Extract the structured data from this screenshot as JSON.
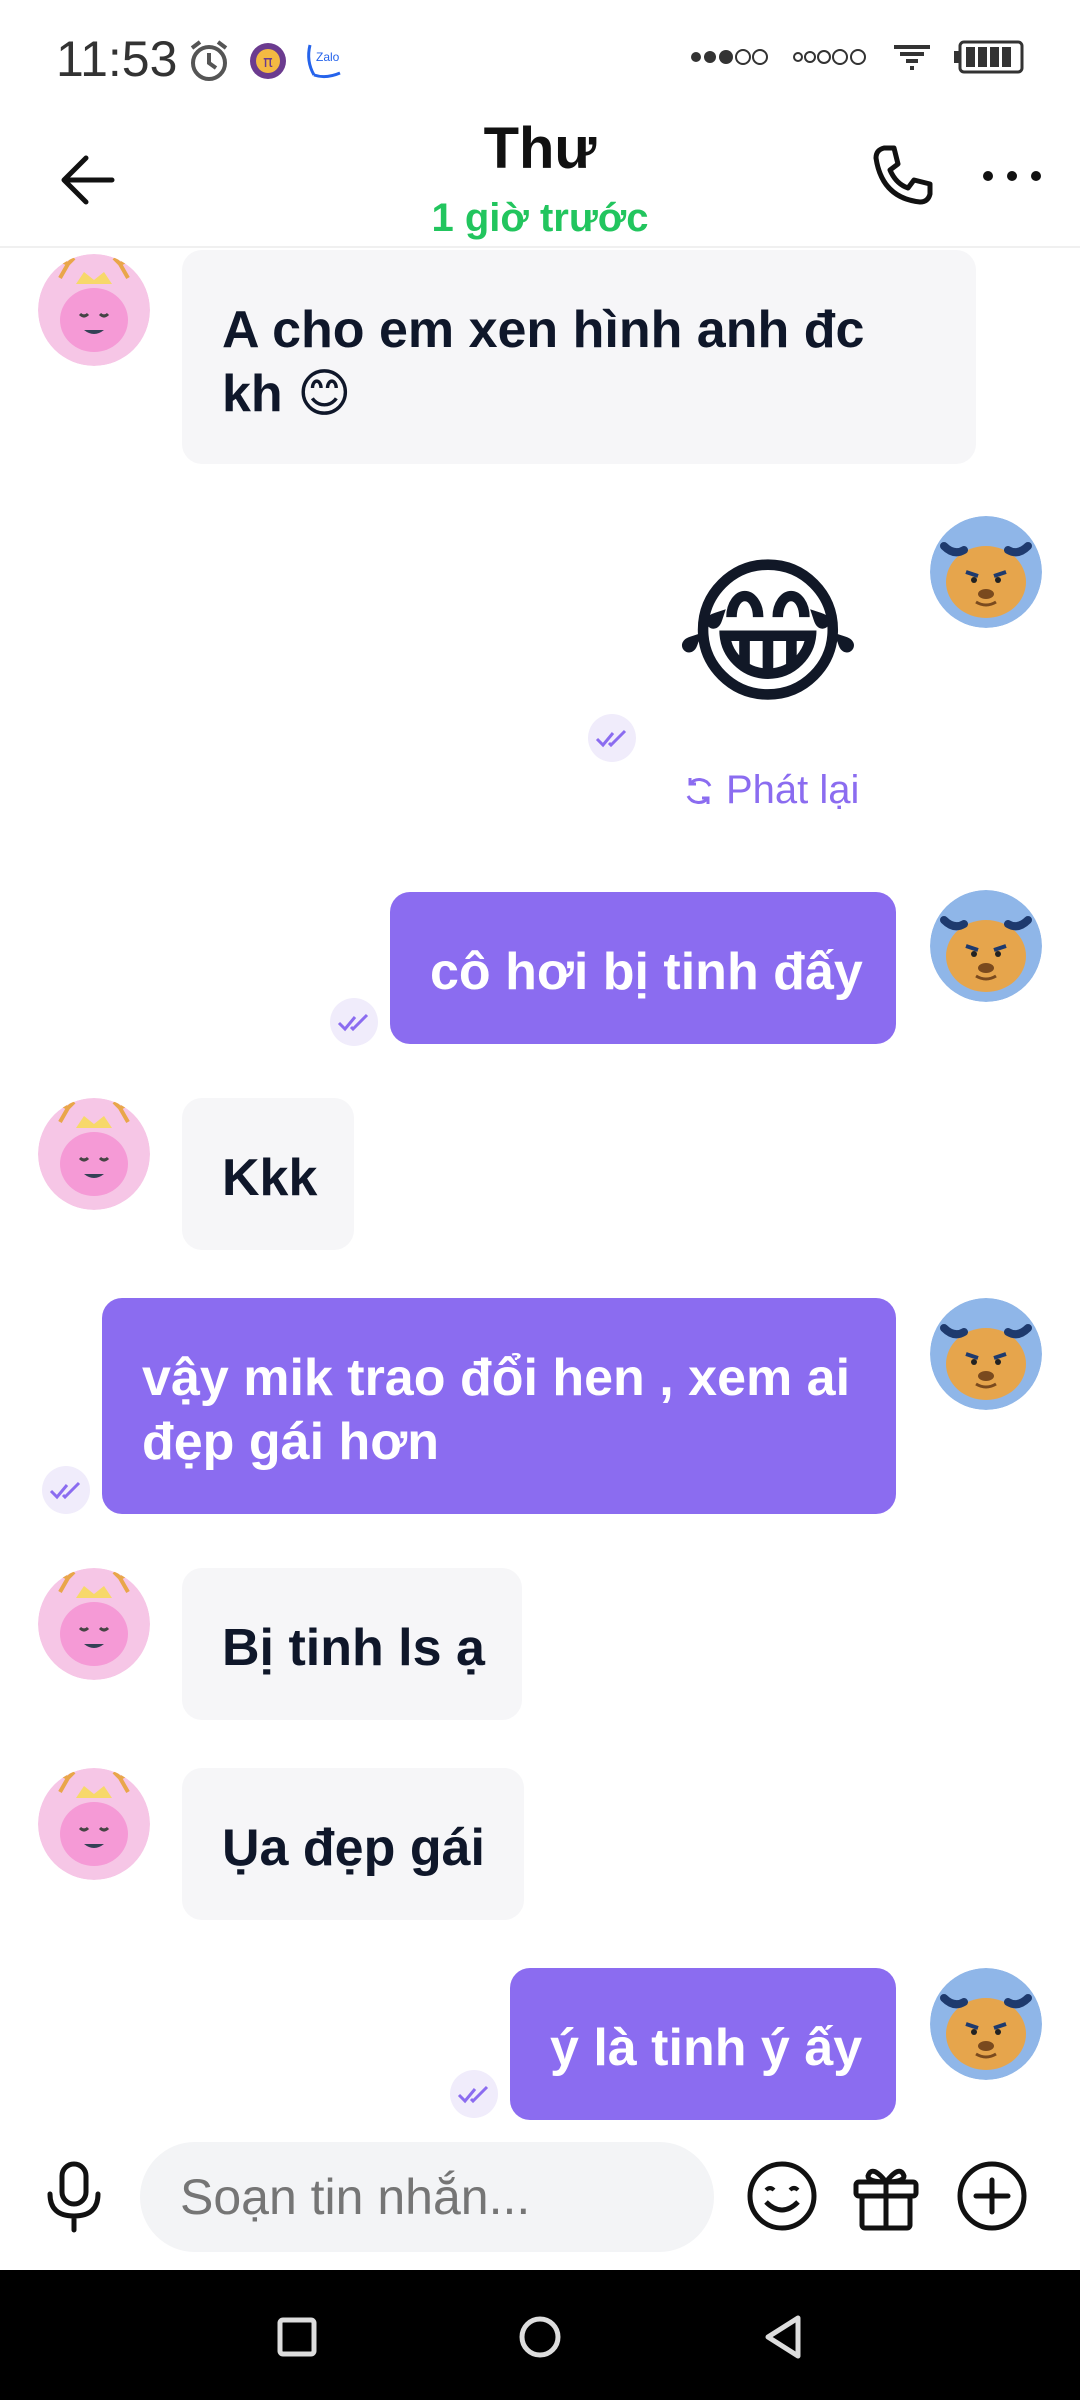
{
  "status_bar": {
    "time": "11:53",
    "left_icons": [
      "alarm-icon",
      "pi-app-icon",
      "zalo-icon"
    ],
    "right_icons": [
      "signal-dots-icon",
      "signal-dots-icon",
      "wifi-icon",
      "battery-icon"
    ],
    "zalo_label": "Zalo"
  },
  "header": {
    "contact_name": "Thư",
    "contact_status": "1 giờ trước",
    "status_color": "#22c55e"
  },
  "messages": [
    {
      "from": "them",
      "text": "A cho em xen hình anh đc kh 😊"
    },
    {
      "from": "me",
      "type": "sticker",
      "sticker": "😂",
      "replay_label": "Phát lại"
    },
    {
      "from": "me",
      "text": "cô hơi bị tinh đấy"
    },
    {
      "from": "them",
      "text": "Kkk"
    },
    {
      "from": "me",
      "text": "vậy mik trao đổi hen , xem ai đẹp gái hơn"
    },
    {
      "from": "them",
      "text": "Bị tinh ls ạ"
    },
    {
      "from": "them",
      "text": "Ụa đẹp gái"
    },
    {
      "from": "me",
      "text": "ý là tinh ý ấy"
    }
  ],
  "composer": {
    "placeholder": "Soạn tin nhắn..."
  },
  "colors": {
    "accent": "#8b6cf0",
    "incoming_bubble": "#f6f6f8",
    "outgoing_bubble": "#8b6cf0",
    "online": "#22c55e"
  }
}
